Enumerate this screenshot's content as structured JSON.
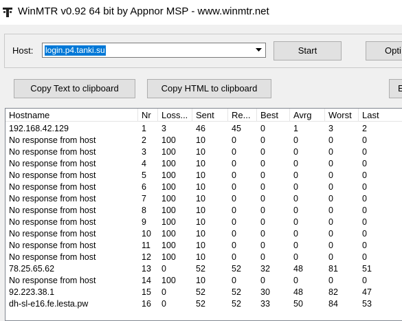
{
  "window": {
    "title": "WinMTR v0.92 64 bit by Appnor MSP - www.winmtr.net",
    "icon": "winmtr-app-icon"
  },
  "controls": {
    "host_label": "Host:",
    "host_value": "login.p4.tanki.su",
    "start_label": "Start",
    "options_label": "Opti",
    "copy_text_label": "Copy Text to clipboard",
    "copy_html_label": "Copy HTML to clipboard",
    "export_label": "E"
  },
  "columns": [
    "Hostname",
    "Nr",
    "Loss...",
    "Sent",
    "Re...",
    "Best",
    "Avrg",
    "Worst",
    "Last"
  ],
  "rows": [
    [
      "192.168.42.129",
      "1",
      "3",
      "46",
      "45",
      "0",
      "1",
      "3",
      "2"
    ],
    [
      "No response from host",
      "2",
      "100",
      "10",
      "0",
      "0",
      "0",
      "0",
      "0"
    ],
    [
      "No response from host",
      "3",
      "100",
      "10",
      "0",
      "0",
      "0",
      "0",
      "0"
    ],
    [
      "No response from host",
      "4",
      "100",
      "10",
      "0",
      "0",
      "0",
      "0",
      "0"
    ],
    [
      "No response from host",
      "5",
      "100",
      "10",
      "0",
      "0",
      "0",
      "0",
      "0"
    ],
    [
      "No response from host",
      "6",
      "100",
      "10",
      "0",
      "0",
      "0",
      "0",
      "0"
    ],
    [
      "No response from host",
      "7",
      "100",
      "10",
      "0",
      "0",
      "0",
      "0",
      "0"
    ],
    [
      "No response from host",
      "8",
      "100",
      "10",
      "0",
      "0",
      "0",
      "0",
      "0"
    ],
    [
      "No response from host",
      "9",
      "100",
      "10",
      "0",
      "0",
      "0",
      "0",
      "0"
    ],
    [
      "No response from host",
      "10",
      "100",
      "10",
      "0",
      "0",
      "0",
      "0",
      "0"
    ],
    [
      "No response from host",
      "11",
      "100",
      "10",
      "0",
      "0",
      "0",
      "0",
      "0"
    ],
    [
      "No response from host",
      "12",
      "100",
      "10",
      "0",
      "0",
      "0",
      "0",
      "0"
    ],
    [
      "78.25.65.62",
      "13",
      "0",
      "52",
      "52",
      "32",
      "48",
      "81",
      "51"
    ],
    [
      "No response from host",
      "14",
      "100",
      "10",
      "0",
      "0",
      "0",
      "0",
      "0"
    ],
    [
      "92.223.38.1",
      "15",
      "0",
      "52",
      "52",
      "30",
      "48",
      "82",
      "47"
    ],
    [
      "dh-sl-e16.fe.lesta.pw",
      "16",
      "0",
      "52",
      "52",
      "33",
      "50",
      "84",
      "53"
    ]
  ],
  "colors": {
    "selection": "#0078d7",
    "button_face": "#e1e1e1",
    "window_bg": "#f0f0f0"
  }
}
